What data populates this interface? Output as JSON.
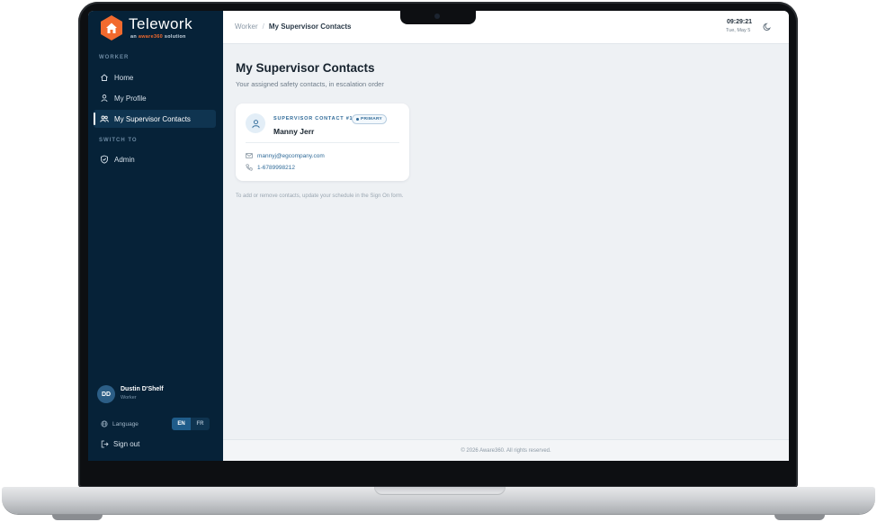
{
  "brand": {
    "title": "Telework",
    "sub_prefix": "an",
    "sub_brand": "aware360",
    "sub_suffix": "solution",
    "accent": "#f26a2e"
  },
  "sidebar": {
    "section_worker": "WORKER",
    "section_switch": "SWITCH TO",
    "items": [
      {
        "label": "Home",
        "icon": "home-icon"
      },
      {
        "label": "My Profile",
        "icon": "user-icon"
      },
      {
        "label": "My Supervisor Contacts",
        "icon": "users-icon",
        "active": true
      }
    ],
    "switch_items": [
      {
        "label": "Admin",
        "icon": "shield-icon"
      }
    ],
    "user": {
      "initials": "DD",
      "name": "Dustin D'Shelf",
      "role": "Worker"
    },
    "language": {
      "label": "Language",
      "options": [
        "EN",
        "FR"
      ],
      "selected": "EN"
    },
    "signout": "Sign out",
    "bg_color": "#062238"
  },
  "topbar": {
    "breadcrumb_root": "Worker",
    "breadcrumb_separator": "/",
    "breadcrumb_current": "My Supervisor Contacts",
    "time": "09:29:21",
    "date": "Tue, May 5"
  },
  "main": {
    "title": "My Supervisor Contacts",
    "subtitle": "Your assigned safety contacts, in escalation order",
    "contacts": [
      {
        "label": "SUPERVISOR CONTACT #1",
        "badge": "PRIMARY",
        "name": "Manny Jerr",
        "email": "mannyj@egcompany.com",
        "phone": "1-6789998212"
      }
    ],
    "hint": "To add or remove contacts, update your schedule in the Sign On form."
  },
  "footer": {
    "text": "© 2026 Aware360. All rights reserved."
  }
}
